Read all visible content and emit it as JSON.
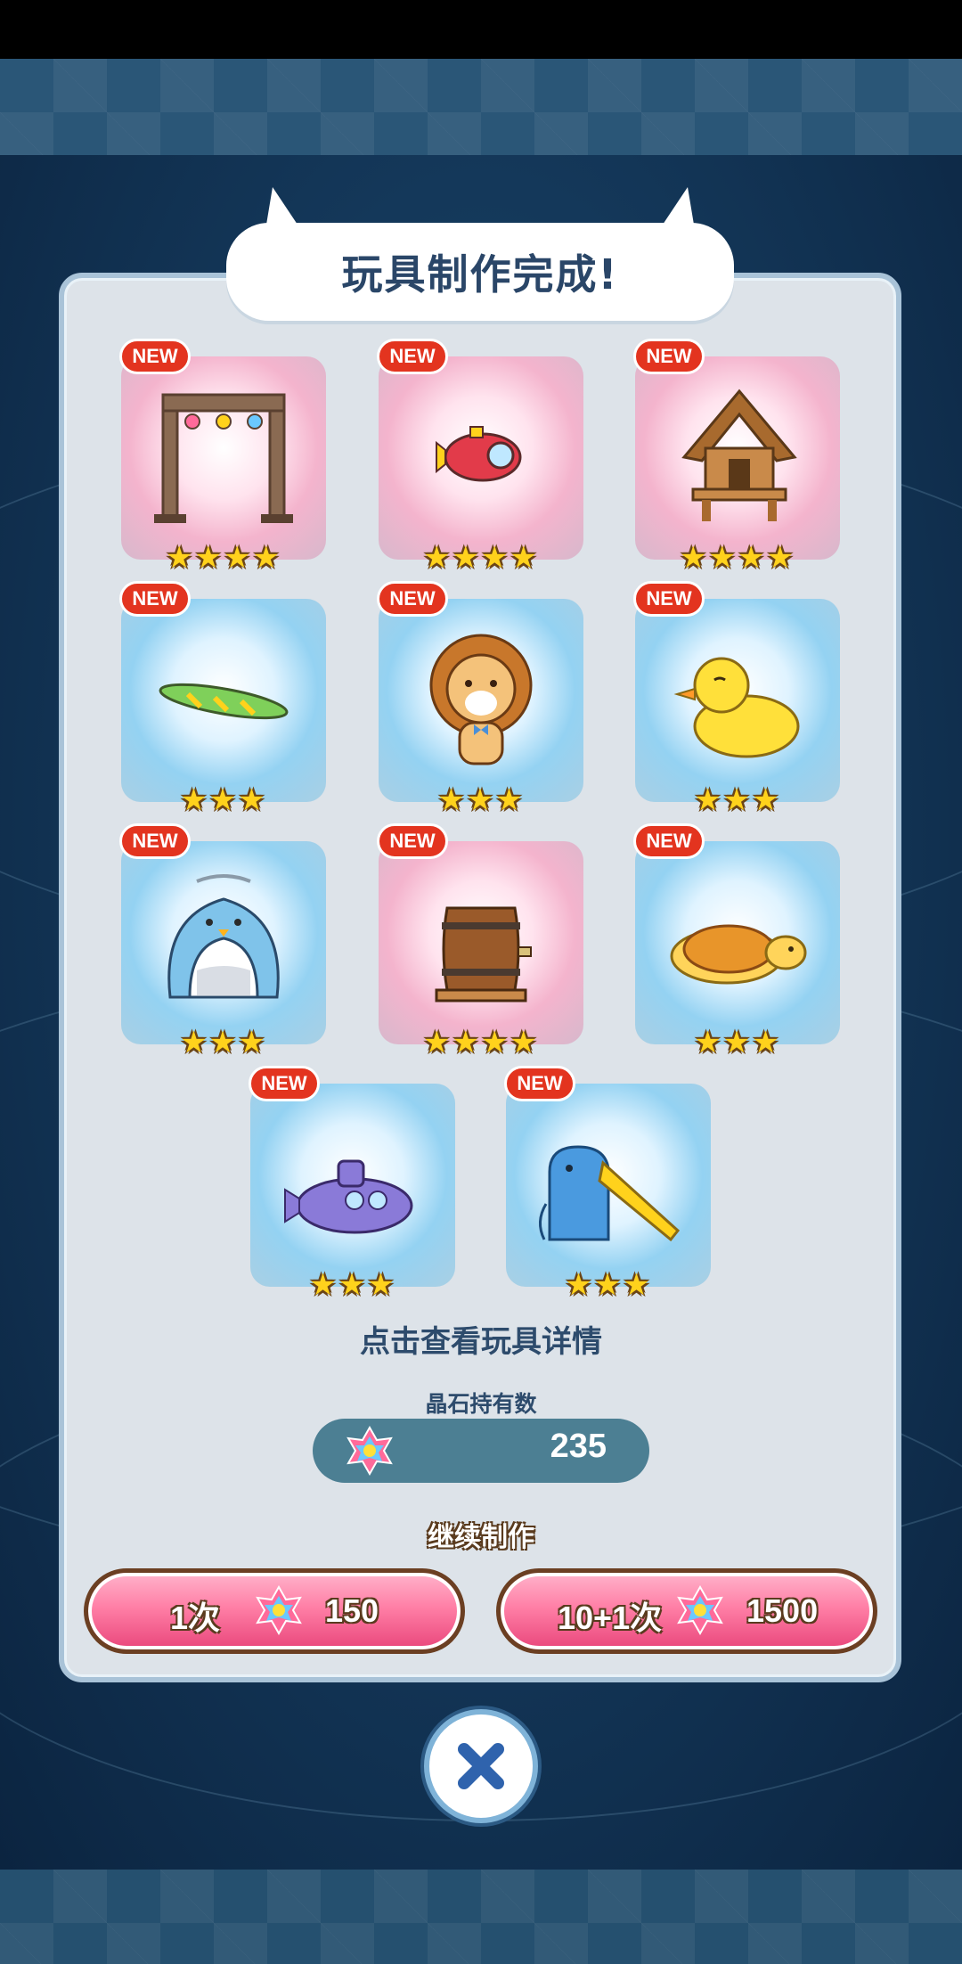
{
  "title": "玩具制作完成!",
  "new_label": "NEW",
  "hint": "点击查看玩具详情",
  "gems": {
    "label": "晶石持有数",
    "value": "235",
    "icon": "rainbow-gem-icon"
  },
  "continue_label": "继续制作",
  "buttons": [
    {
      "label": "1次",
      "cost": "150"
    },
    {
      "label": "10+1次",
      "cost": "1500"
    }
  ],
  "close_icon": "close-x-icon",
  "toys": [
    {
      "name": "stage-truss-toy",
      "stars": 4,
      "rarity": "pink",
      "new": true
    },
    {
      "name": "submarine-toy",
      "stars": 4,
      "rarity": "pink",
      "new": true
    },
    {
      "name": "wooden-hut-toy",
      "stars": 4,
      "rarity": "pink",
      "new": true
    },
    {
      "name": "surfboard-toy",
      "stars": 3,
      "rarity": "blue",
      "new": true
    },
    {
      "name": "lion-toy",
      "stars": 3,
      "rarity": "blue",
      "new": true
    },
    {
      "name": "rubber-duck-toy",
      "stars": 3,
      "rarity": "blue",
      "new": true
    },
    {
      "name": "penguin-tent-toy",
      "stars": 3,
      "rarity": "blue",
      "new": true
    },
    {
      "name": "wooden-barrel-toy",
      "stars": 4,
      "rarity": "pink",
      "new": true
    },
    {
      "name": "sea-turtle-toy",
      "stars": 3,
      "rarity": "blue",
      "new": true
    },
    {
      "name": "purple-submarine-toy",
      "stars": 3,
      "rarity": "blue",
      "new": true
    },
    {
      "name": "elephant-slide-toy",
      "stars": 3,
      "rarity": "blue",
      "new": true
    }
  ],
  "colors": {
    "pink_rarity": "#f4b4cd",
    "blue_rarity": "#94d2f2",
    "star": "#ffd21c",
    "button": "#ff7fa6"
  }
}
